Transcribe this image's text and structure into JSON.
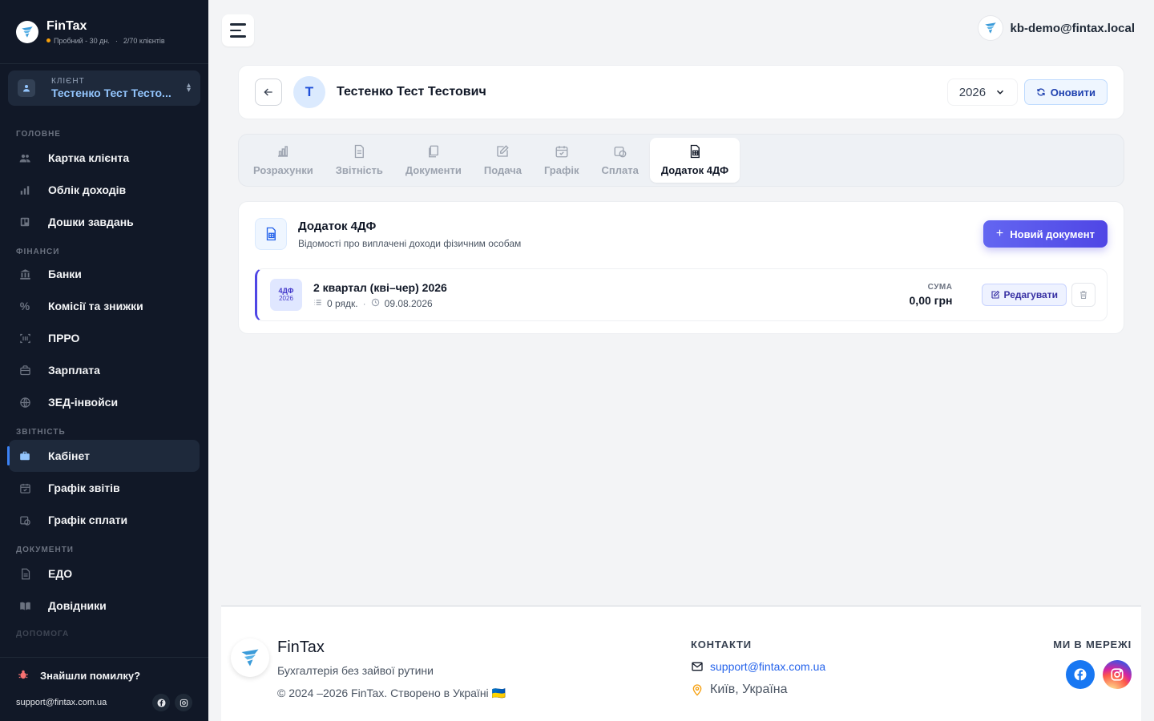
{
  "brand": {
    "name": "FinTax",
    "trial": "Пробний - 30 дн.",
    "clients": "2/70 клієнтів"
  },
  "client_selector": {
    "label": "КЛІЄНТ",
    "name": "Тестенко Тест Тесто..."
  },
  "sidebar": {
    "sections": [
      {
        "label": "ГОЛОВНЕ",
        "items": [
          {
            "label": "Картка клієнта",
            "icon": "users-icon"
          },
          {
            "label": "Облік доходів",
            "icon": "bar-chart-icon"
          },
          {
            "label": "Дошки завдань",
            "icon": "board-icon"
          }
        ]
      },
      {
        "label": "ФІНАНСИ",
        "items": [
          {
            "label": "Банки",
            "icon": "bank-icon"
          },
          {
            "label": "Комісії та знижки",
            "icon": "percent-icon"
          },
          {
            "label": "ПРРО",
            "icon": "barcode-icon"
          },
          {
            "label": "Зарплата",
            "icon": "wallet-icon"
          },
          {
            "label": "ЗЕД-інвойси",
            "icon": "globe-icon"
          }
        ]
      },
      {
        "label": "ЗВІТНІСТЬ",
        "items": [
          {
            "label": "Кабінет",
            "icon": "briefcase-icon",
            "active": true
          },
          {
            "label": "Графік звітів",
            "icon": "calendar-check-icon"
          },
          {
            "label": "Графік сплати",
            "icon": "payment-schedule-icon"
          }
        ]
      },
      {
        "label": "ДОКУМЕНТИ",
        "items": [
          {
            "label": "ЕДО",
            "icon": "edo-icon"
          },
          {
            "label": "Довідники",
            "icon": "book-icon"
          }
        ]
      }
    ],
    "partial_section": "ДОПОМОГА",
    "bug_report": "Знайшли помилку?",
    "support_email": "support@fintax.com.ua"
  },
  "topbar": {
    "user_email": "kb-demo@fintax.local"
  },
  "client_header": {
    "avatar_letter": "Т",
    "name": "Тестенко Тест Тестович",
    "year": "2026",
    "refresh_label": "Оновити"
  },
  "tabs": [
    {
      "label": "Розрахунки",
      "icon": "chart-icon"
    },
    {
      "label": "Звітність",
      "icon": "file-text-icon"
    },
    {
      "label": "Документи",
      "icon": "documents-icon"
    },
    {
      "label": "Подача",
      "icon": "edit-icon"
    },
    {
      "label": "Графік",
      "icon": "calendar-icon"
    },
    {
      "label": "Сплата",
      "icon": "payment-icon"
    },
    {
      "label": "Додаток 4ДФ",
      "icon": "spreadsheet-icon",
      "active": true
    }
  ],
  "section": {
    "title": "Додаток 4ДФ",
    "subtitle": "Відомості про виплачені доходи фізичним особам",
    "new_button": "Новий документ"
  },
  "documents": [
    {
      "badge_top": "4ДФ",
      "badge_bottom": "2026",
      "title": "2 квартал (кві–чер) 2026",
      "rows": "0 рядк.",
      "date": "09.08.2026",
      "sum_label": "СУМА",
      "sum": "0,00 грн",
      "edit_label": "Редагувати"
    }
  ],
  "footer": {
    "brand": "FinTax",
    "tagline": "Бухгалтерія без зайвої рутини",
    "copyright": "© 2024 –2026 FinTax. Створено в Україні 🇺🇦",
    "contacts_heading": "КОНТАКТИ",
    "email": "support@fintax.com.ua",
    "city": "Київ, Україна",
    "social_heading": "МИ В МЕРЕЖІ"
  },
  "colors": {
    "sidebar_bg": "#111827",
    "accent": "#4f46e5",
    "link": "#2563eb",
    "facebook": "#1877f2"
  }
}
